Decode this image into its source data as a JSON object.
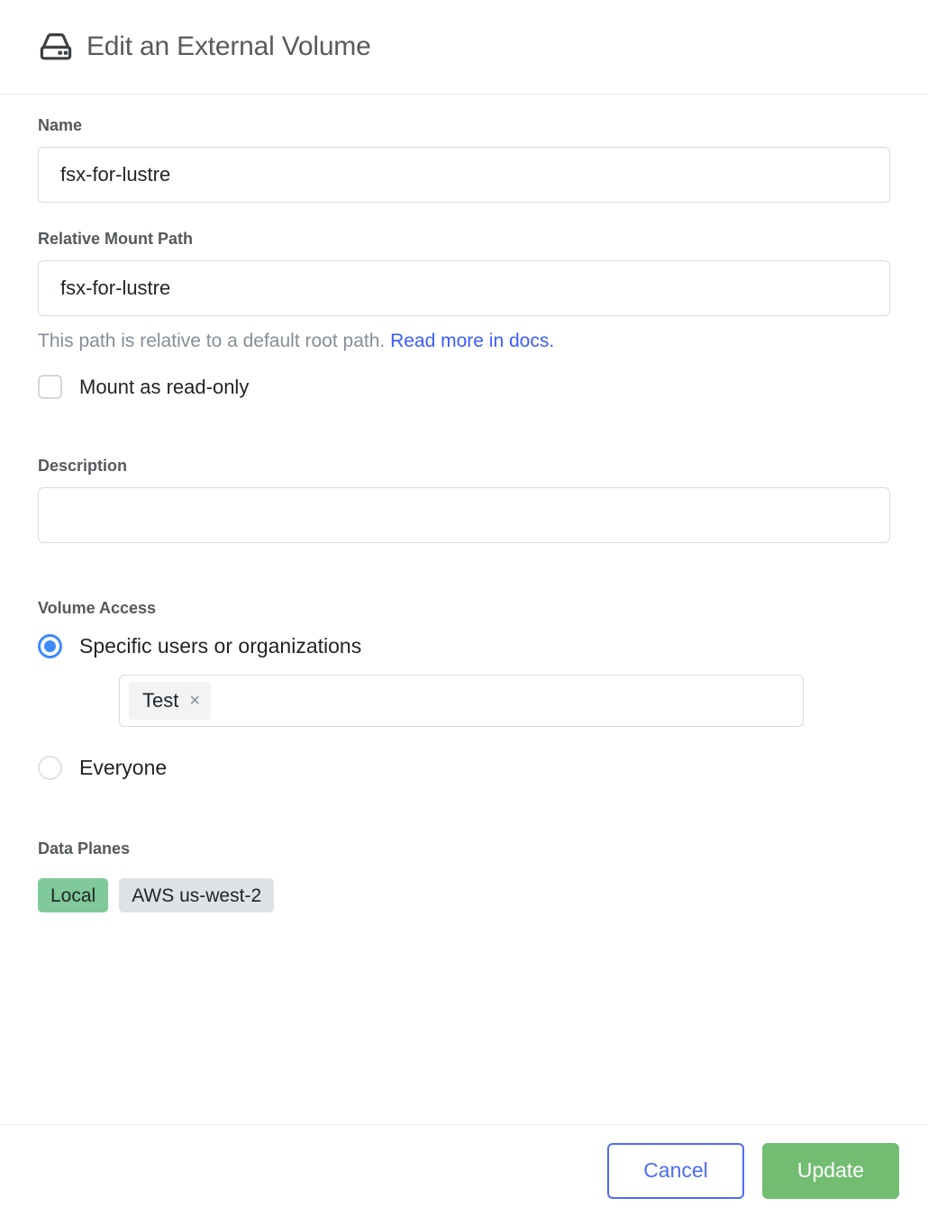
{
  "header": {
    "icon": "hard-drive-icon",
    "title": "Edit an External Volume"
  },
  "form": {
    "name": {
      "label": "Name",
      "value": "fsx-for-lustre",
      "placeholder": ""
    },
    "relative_mount_path": {
      "label": "Relative Mount Path",
      "value": "fsx-for-lustre",
      "placeholder": "",
      "help_text": "This path is relative to a default root path.",
      "help_link": "Read more in docs."
    },
    "read_only": {
      "label": "Mount as read-only",
      "checked": false
    },
    "description": {
      "label": "Description",
      "value": "",
      "placeholder": ""
    },
    "volume_access": {
      "label": "Volume Access",
      "selected": "specific",
      "options": [
        {
          "id": "specific",
          "label": "Specific users or organizations"
        },
        {
          "id": "everyone",
          "label": "Everyone"
        }
      ],
      "tags": [
        {
          "label": "Test",
          "remove_glyph": "×"
        }
      ],
      "tag_input_placeholder": ""
    },
    "data_planes": {
      "label": "Data Planes",
      "badges": [
        {
          "label": "Local",
          "style": "green"
        },
        {
          "label": "AWS us-west-2",
          "style": "grey"
        }
      ]
    }
  },
  "footer": {
    "cancel_label": "Cancel",
    "update_label": "Update"
  },
  "colors": {
    "accent_blue": "#3d8bfd",
    "link_blue": "#3b5bfd",
    "button_blue": "#4e6bf5",
    "primary_green": "#72bd72",
    "badge_green": "#7fc99a",
    "badge_grey": "#dee2e6",
    "border_grey": "#d8dbdf",
    "label_grey": "#55595c",
    "help_grey": "#868e96"
  }
}
